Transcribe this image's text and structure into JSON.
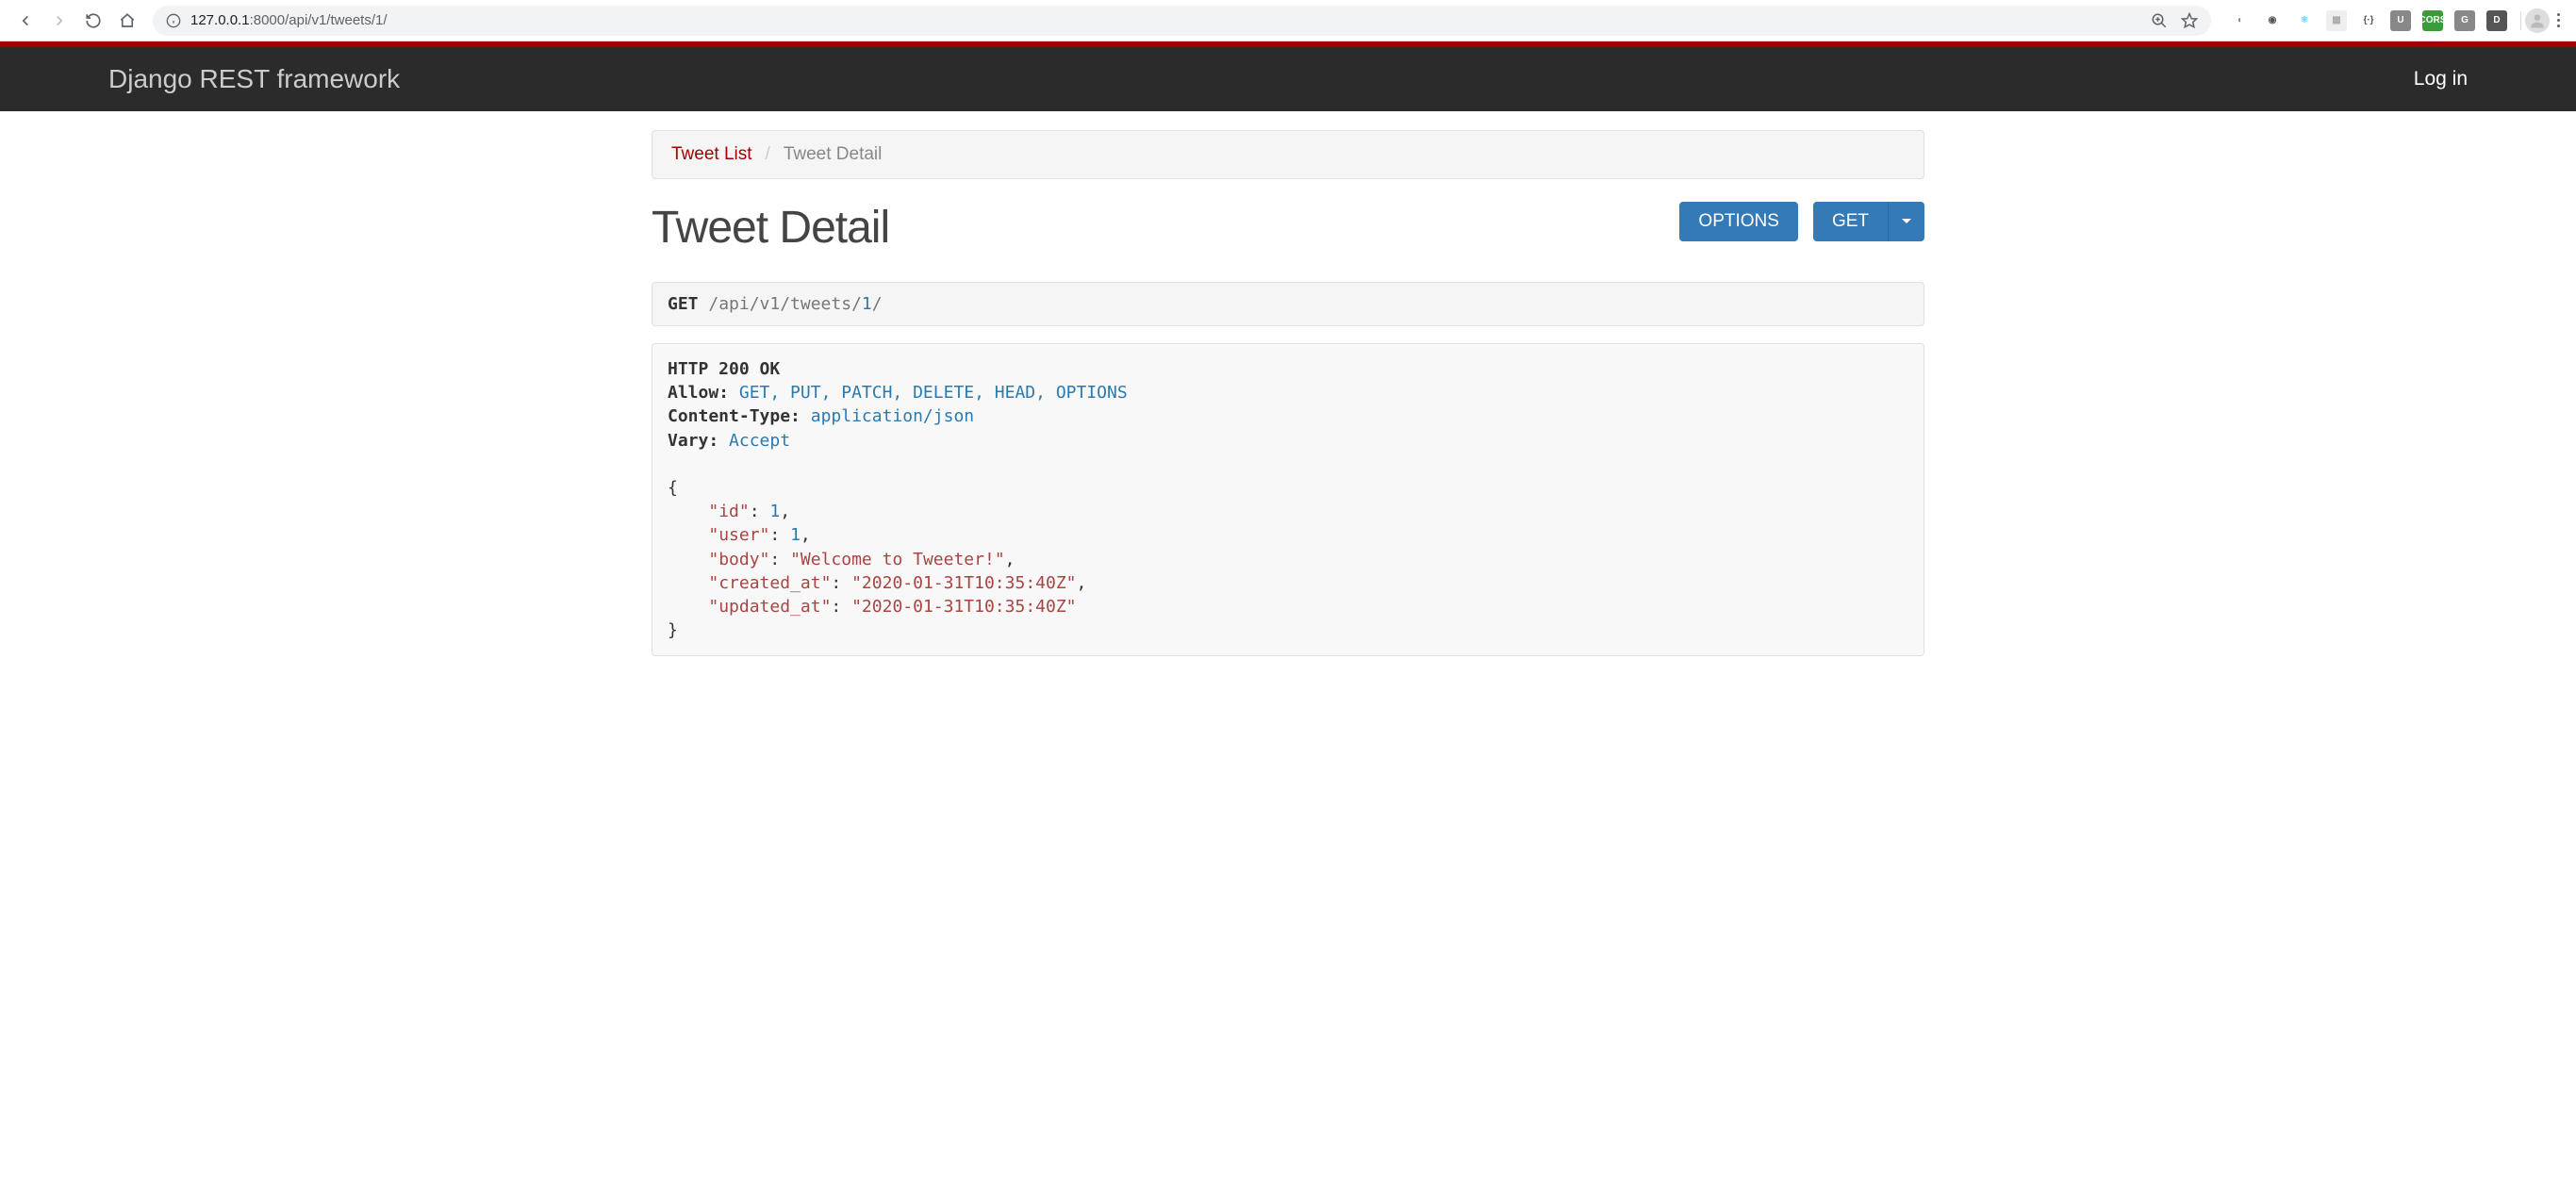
{
  "browser": {
    "url_display": "127.0.0.1:8000/api/v1/tweets/1/",
    "url_host": "127.0.0.1",
    "url_port": ":8000",
    "url_path": "/api/v1/tweets/1/"
  },
  "navbar": {
    "brand": "Django REST framework",
    "login": "Log in"
  },
  "breadcrumb": {
    "parent": "Tweet List",
    "sep": "/",
    "current": "Tweet Detail"
  },
  "page": {
    "title": "Tweet Detail",
    "options_btn": "OPTIONS",
    "get_btn": "GET"
  },
  "request": {
    "method": "GET",
    "path_prefix": " /api/v1/tweets/",
    "path_id": "1",
    "path_suffix": "/"
  },
  "response": {
    "status_line": "HTTP 200 OK",
    "headers": [
      {
        "name": "Allow:",
        "value": " GET, PUT, PATCH, DELETE, HEAD, OPTIONS"
      },
      {
        "name": "Content-Type:",
        "value": " application/json"
      },
      {
        "name": "Vary:",
        "value": " Accept"
      }
    ],
    "body": {
      "id": 1,
      "user": 1,
      "body": "Welcome to Tweeter!",
      "created_at": "2020-01-31T10:35:40Z",
      "updated_at": "2020-01-31T10:35:40Z"
    }
  },
  "ext_icons": [
    {
      "name": "opera-icon",
      "bg": "#fff",
      "fg": "#888",
      "txt": "◐"
    },
    {
      "name": "circle-icon",
      "bg": "#fff",
      "fg": "#555",
      "txt": "◉"
    },
    {
      "name": "react-icon",
      "bg": "#fff",
      "fg": "#61dafb",
      "txt": "⚛"
    },
    {
      "name": "grid-icon",
      "bg": "#eee",
      "fg": "#aaa",
      "txt": "▦"
    },
    {
      "name": "brackets-icon",
      "bg": "#fff",
      "fg": "#555",
      "txt": "{·}"
    },
    {
      "name": "u-icon",
      "bg": "#888",
      "fg": "#fff",
      "txt": "U"
    },
    {
      "name": "cors-icon",
      "bg": "#3a9b3a",
      "fg": "#fff",
      "txt": "CORS"
    },
    {
      "name": "g-icon",
      "bg": "#888",
      "fg": "#fff",
      "txt": "G"
    },
    {
      "name": "d-icon",
      "bg": "#555",
      "fg": "#fff",
      "txt": "D"
    }
  ]
}
